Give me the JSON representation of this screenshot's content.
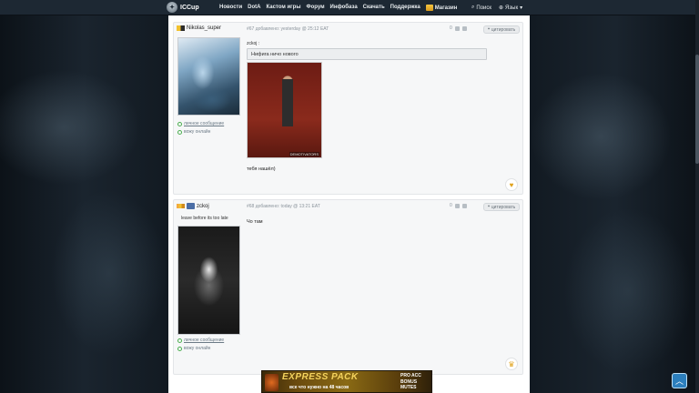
{
  "header": {
    "logo_text": "ICCup",
    "nav": [
      "Новости",
      "DotA",
      "Кастом игры",
      "Форум",
      "Инфобаза",
      "Скачать",
      "Поддержка"
    ],
    "shop_label": "Магазин",
    "search_label": "Поиск",
    "language_label": "Язык"
  },
  "posts": [
    {
      "author": "Nikolas_super",
      "meta": "#67 добавлено: yesterday @ 25:12 EAT",
      "vote_count": "0",
      "quote_button": "цитировать",
      "quote_author": "zckoj :",
      "quote_text": "Нифига ничо нового",
      "quote_image_caption": "DEMOTIVATORS",
      "body": "тебя нашёл)",
      "links": [
        "личное сообщение",
        "вожу онлайн"
      ]
    },
    {
      "author": "zckoj",
      "status": "leave before its too late",
      "meta": "#68 добавлено: today @ 13:21 EAT",
      "vote_count": "0",
      "quote_button": "цитировать",
      "body": "Чо там",
      "links": [
        "личное сообщение",
        "вожу онлайн"
      ]
    }
  ],
  "banner": {
    "title": "EXPRESS PACK",
    "subtitle": "все что нужно на 48 часов",
    "side_lines": [
      "PRO ACC",
      "BONUS",
      "MUTES"
    ]
  }
}
